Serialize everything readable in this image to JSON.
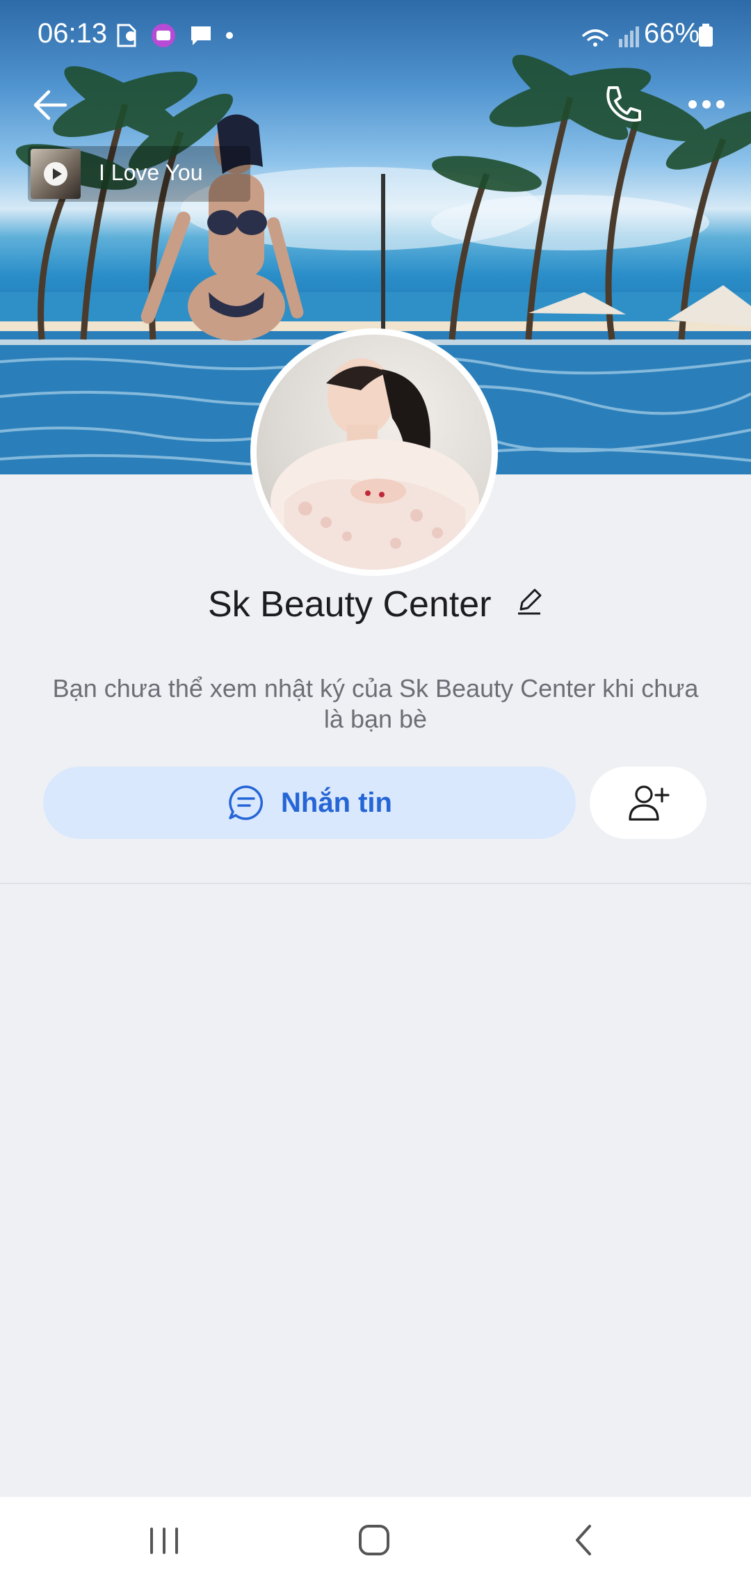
{
  "status_bar": {
    "time": "06:13",
    "battery": "66%",
    "notification_icons": [
      "sim-info-icon",
      "app-notification-icon",
      "message-icon",
      "dot-icon"
    ]
  },
  "cover": {
    "music": {
      "title": "I Love You",
      "icon": "play-icon"
    }
  },
  "profile": {
    "name": "Sk Beauty Center",
    "notice": "Bạn chưa thể xem nhật ký của Sk Beauty Center khi chưa là bạn bè"
  },
  "actions": {
    "message_label": "Nhắn tin",
    "message_icon": "chat-bubble-icon",
    "add_friend_icon": "add-user-icon"
  },
  "colors": {
    "accent": "#2565d6",
    "accent_bg": "#d9e8fd",
    "page_bg": "#eff0f4"
  }
}
